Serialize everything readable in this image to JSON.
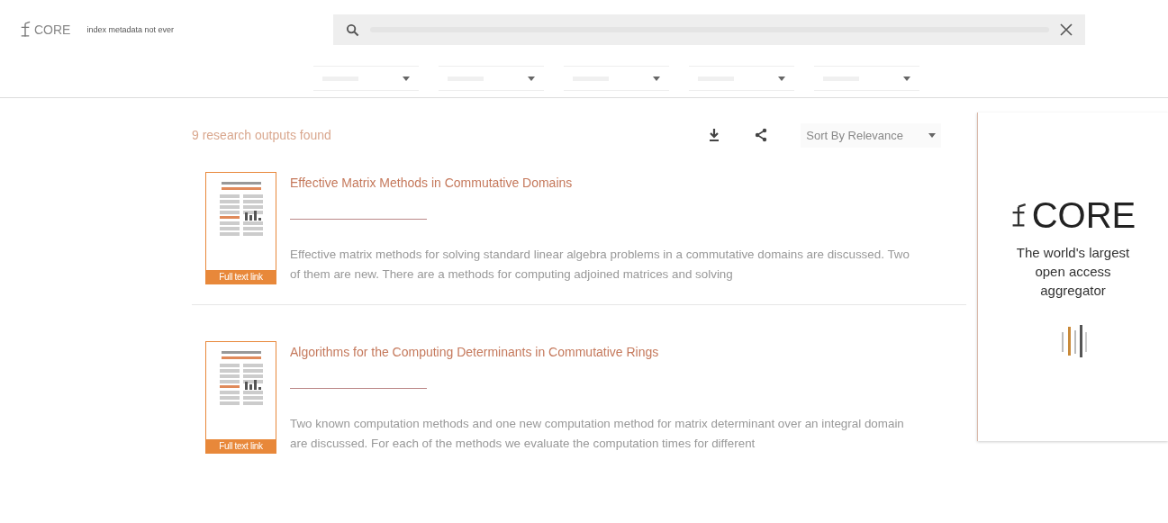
{
  "header": {
    "logo": "CORE",
    "tagline": "index metadata not ever"
  },
  "results_count": "9 research outputs found",
  "sort": {
    "value": "Sort By Relevance"
  },
  "results": [
    {
      "title": "Effective Matrix Methods in Commutative Domains",
      "abstract": "Effective matrix methods for solving standard linear algebra problems in a commutative domains are discussed. Two of them are new. There are a methods for computing adjoined matrices and solving",
      "badge": "Full text link"
    },
    {
      "title": "Algorithms for the Computing Determinants in Commutative Rings",
      "abstract": "Two known computation methods and one new computation method for matrix determinant over an integral domain are discussed. For each of the methods we evaluate the computation times for different",
      "badge": "Full text link"
    }
  ],
  "ad": {
    "logo": "CORE",
    "tagline": "The world's largest open access aggregator"
  }
}
